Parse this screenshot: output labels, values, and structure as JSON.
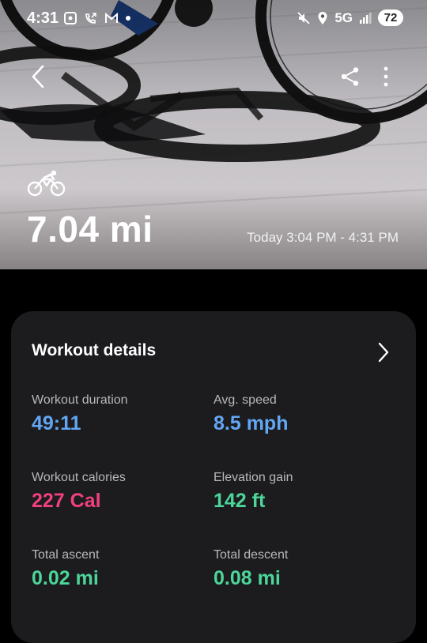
{
  "status_bar": {
    "time": "4:31",
    "network": "5G",
    "battery": "72"
  },
  "hero": {
    "distance": "7.04 mi",
    "time_range": "Today 3:04 PM - 4:31 PM"
  },
  "workout_details": {
    "title": "Workout details",
    "metrics": [
      {
        "label": "Workout duration",
        "value": "49:11",
        "color": "#62a6f4"
      },
      {
        "label": "Avg. speed",
        "value": "8.5 mph",
        "color": "#62a6f4"
      },
      {
        "label": "Workout calories",
        "value": "227 Cal",
        "color": "#f0407e"
      },
      {
        "label": "Elevation gain",
        "value": "142 ft",
        "color": "#4cd69a"
      },
      {
        "label": "Total ascent",
        "value": "0.02 mi",
        "color": "#4cd69a"
      },
      {
        "label": "Total descent",
        "value": "0.08 mi",
        "color": "#4cd69a"
      }
    ]
  },
  "icons": [
    "back-icon",
    "share-icon",
    "more-icon",
    "cycling-icon",
    "chevron-right-icon"
  ]
}
